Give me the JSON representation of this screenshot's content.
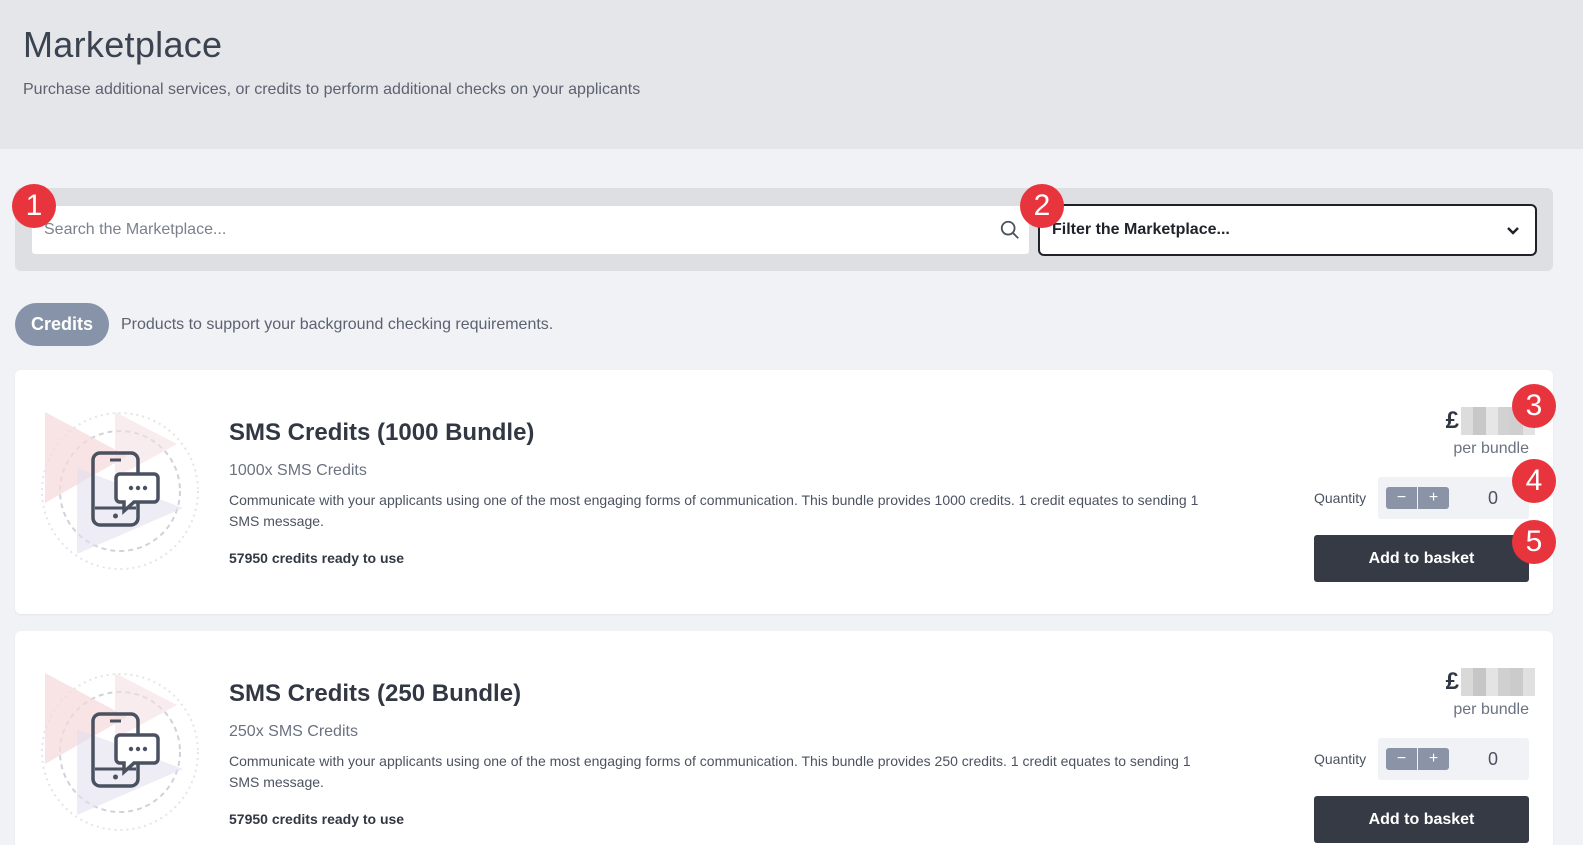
{
  "page": {
    "title": "Marketplace",
    "subtitle": "Purchase additional services, or credits to perform additional checks on your applicants"
  },
  "search": {
    "placeholder": "Search the Marketplace...",
    "icon": "search-icon"
  },
  "filter": {
    "label": "Filter the Marketplace...",
    "icon": "chevron-down-icon"
  },
  "category": {
    "pill": "Credits",
    "description": "Products to support your background checking requirements."
  },
  "products": [
    {
      "title": "SMS Credits (1000 Bundle)",
      "subtitle": "1000x SMS Credits",
      "description": "Communicate with your applicants using one of the most engaging forms of communication. This bundle provides 1000 credits. 1 credit equates to sending 1 SMS message.",
      "ready": "57950 credits ready to use",
      "currency": "£",
      "price_unit": "per bundle",
      "quantity_label": "Quantity",
      "quantity": "0",
      "minus": "−",
      "plus": "+",
      "add_label": "Add to basket"
    },
    {
      "title": "SMS Credits (250 Bundle)",
      "subtitle": "250x SMS Credits",
      "description": "Communicate with your applicants using one of the most engaging forms of communication. This bundle provides 250 credits. 1 credit equates to sending 1 SMS message.",
      "ready": "57950 credits ready to use",
      "currency": "£",
      "price_unit": "per bundle",
      "quantity_label": "Quantity",
      "quantity": "0",
      "minus": "−",
      "plus": "+",
      "add_label": "Add to basket"
    }
  ],
  "annotations": [
    "1",
    "2",
    "3",
    "4",
    "5"
  ],
  "colors": {
    "badge": "#e8353d",
    "pill": "#8793a8",
    "button_dark": "#353a44",
    "header_bg": "#e5e6ea"
  }
}
